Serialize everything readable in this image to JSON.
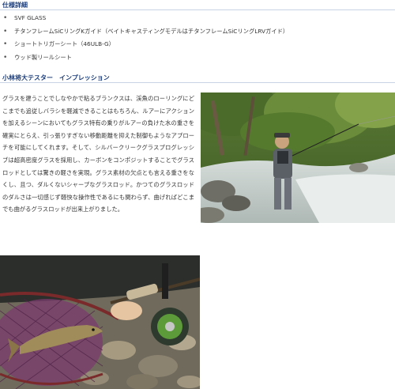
{
  "specs": {
    "heading": "仕様詳細",
    "items": [
      "SVF GLASS",
      "チタンフレームSiCリングKガイド（ベイトキャスティングモデルはチタンフレームSiCリングLRVガイド）",
      "ショートトリガーシート（46ULB-G）",
      "ウッド製リールシート"
    ]
  },
  "impression": {
    "heading": "小林将大テスター　インプレッション",
    "text": "グラスを建うことでしなやかで粘るブランクスは、渓魚のローリングにどこまでも追従しバラシを軽減できることはもちろん、ルアーにアクションを加えるシーンにおいてもグラス特有の乗りがルアーの負けた水の重さを確実にとらえ、引っ張りすぎない移動距離を抑えた制御もようなアプローチを可能にしてくれます。そして、シルバークリークグラスプログレッシブは超高密度グラスを採用し、カーボンをコンポジットすることでグラスロッドとしては驚きの軽さを実現。グラス素材の欠点とも言える重さをなくし、且つ、ダルくないシャープなグラスロッド。かつてのグラスロッドのダルさは一切感じず軽快な操作性であるにも関わらず、曲げればどこまでも曲がるグラスロッドが出来上がりました。"
  },
  "photos": {
    "angler_alt": "river-angler-photo",
    "catch_alt": "trout-in-net-photo"
  }
}
